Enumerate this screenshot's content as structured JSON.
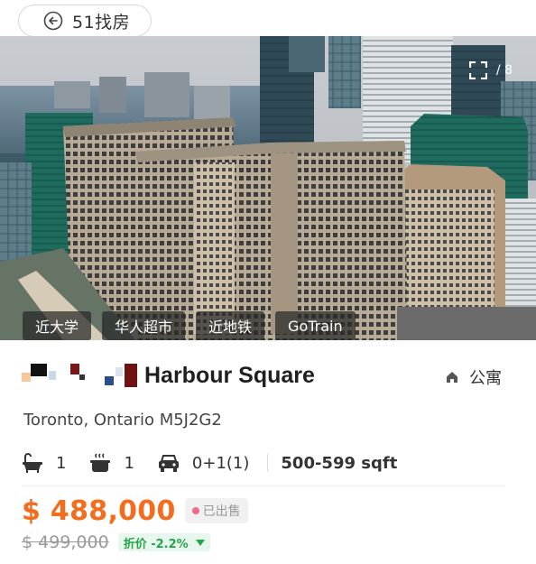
{
  "nav": {
    "back_label": "51找房",
    "back_icon": "arrow-left-circle-icon"
  },
  "gallery": {
    "counter": "/ 8",
    "fullscreen_icon": "fullscreen-icon",
    "tags": [
      "近大学",
      "华人超市",
      "近地铁",
      "GoTrain"
    ]
  },
  "listing": {
    "title": "Harbour Square",
    "type_icon": "home-icon",
    "type_label": "公寓",
    "address": "Toronto, Ontario M5J2G2",
    "stats": {
      "bath_icon": "bathtub-icon",
      "bath": "1",
      "kitchen_icon": "cooking-pot-icon",
      "kitchen": "1",
      "parking_icon": "car-icon",
      "parking": "0+1(1)",
      "sqft": "500-599 sqft"
    },
    "price": "$ 488,000",
    "status": "已出售",
    "old_price": "$ 499,000",
    "discount_label": "折价 -2.2%"
  },
  "colors": {
    "price": "#f26d1d",
    "discount": "#27a34a",
    "sold_dot": "#f06b8b"
  }
}
